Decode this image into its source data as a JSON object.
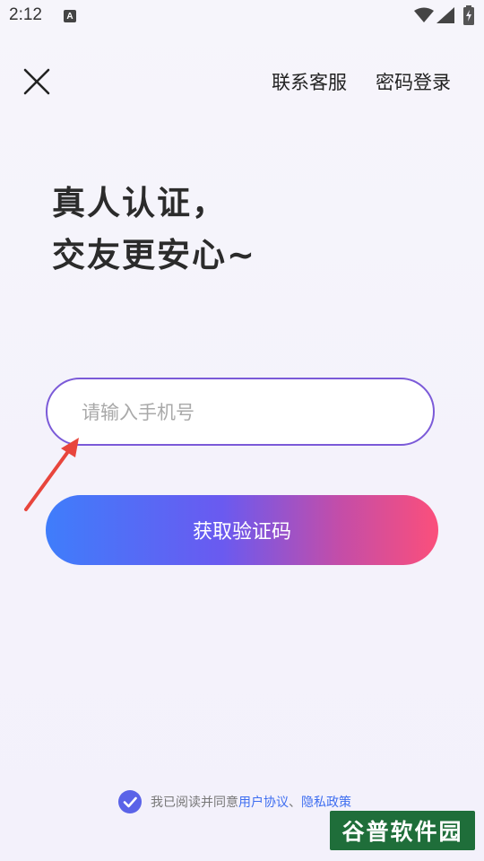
{
  "status_bar": {
    "time": "2:12",
    "notification_icon": "A"
  },
  "header": {
    "close_icon": "close-icon",
    "contact_service": "联系客服",
    "password_login": "密码登录"
  },
  "headline": {
    "line1": "真人认证，",
    "line2": "交友更安心~"
  },
  "form": {
    "phone_placeholder": "请输入手机号",
    "phone_value": "",
    "get_code_label": "获取验证码"
  },
  "agreement": {
    "checked": true,
    "prefix": "我已阅读并同意",
    "user_agreement": "用户协议",
    "separator": "、",
    "privacy_policy": "隐私政策"
  },
  "watermark": {
    "text": "谷普软件园"
  },
  "colors": {
    "accent_border": "#7b5ad8",
    "gradient_start": "#3f7dfb",
    "gradient_end": "#fb4f7b",
    "link": "#3e6ef0",
    "arrow": "#e8453c"
  }
}
